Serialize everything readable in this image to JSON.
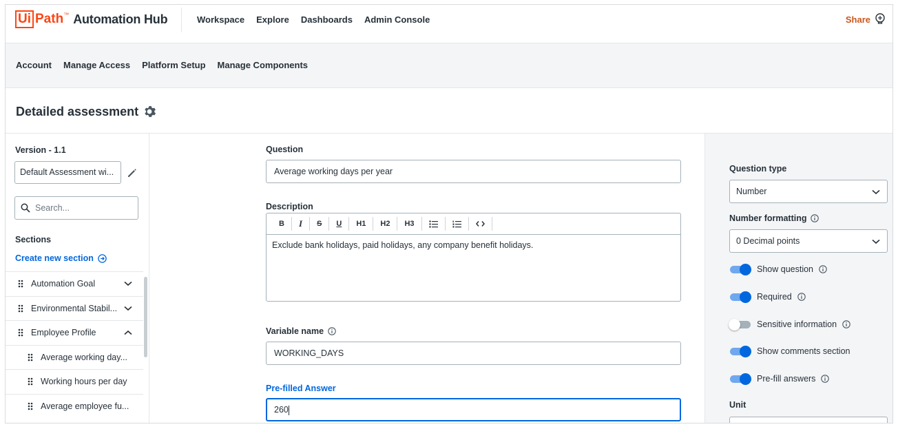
{
  "brand": {
    "logo_box": "Ui",
    "logo_path": "Path",
    "logo_tm": "™",
    "product": "Automation Hub"
  },
  "topnav": {
    "items": [
      "Workspace",
      "Explore",
      "Dashboards",
      "Admin Console"
    ],
    "share": "Share"
  },
  "subnav": {
    "items": [
      "Account",
      "Manage Access",
      "Platform Setup",
      "Manage Components"
    ]
  },
  "page": {
    "title": "Detailed assessment"
  },
  "sidebar": {
    "version": "Version - 1.1",
    "version_select": "Default Assessment wi...",
    "search_placeholder": "Search...",
    "sections_heading": "Sections",
    "create_section": "Create new section",
    "sections": [
      {
        "label": "Automation Goal",
        "expanded": false
      },
      {
        "label": "Environmental Stabil...",
        "expanded": false
      },
      {
        "label": "Employee Profile",
        "expanded": true
      }
    ],
    "questions": [
      "Average working day...",
      "Working hours per day",
      "Average employee fu..."
    ]
  },
  "form": {
    "question_label": "Question",
    "question_value": "Average working days per year",
    "description_label": "Description",
    "toolbar": [
      "B",
      "I",
      "S",
      "U",
      "H1",
      "H2",
      "H3",
      "ul",
      "ol",
      "code"
    ],
    "description_value": "Exclude bank holidays, paid holidays, any company benefit holidays.",
    "variable_label": "Variable name",
    "variable_value": "WORKING_DAYS",
    "prefilled_label": "Pre-filled Answer",
    "prefilled_value": "260"
  },
  "settings": {
    "question_type_label": "Question type",
    "question_type_value": "Number",
    "number_format_label": "Number formatting",
    "number_format_value": "0 Decimal points",
    "toggles": [
      {
        "label": "Show question",
        "on": true,
        "info": true
      },
      {
        "label": "Required",
        "on": true,
        "info": true
      },
      {
        "label": "Sensitive information",
        "on": false,
        "info": true
      },
      {
        "label": "Show comments section",
        "on": true,
        "info": false
      },
      {
        "label": "Pre-fill answers",
        "on": true,
        "info": true
      }
    ],
    "unit_label": "Unit"
  },
  "colors": {
    "brand_orange": "#fa4616",
    "accent_blue": "#0067df",
    "share_orange": "#c8581f"
  }
}
